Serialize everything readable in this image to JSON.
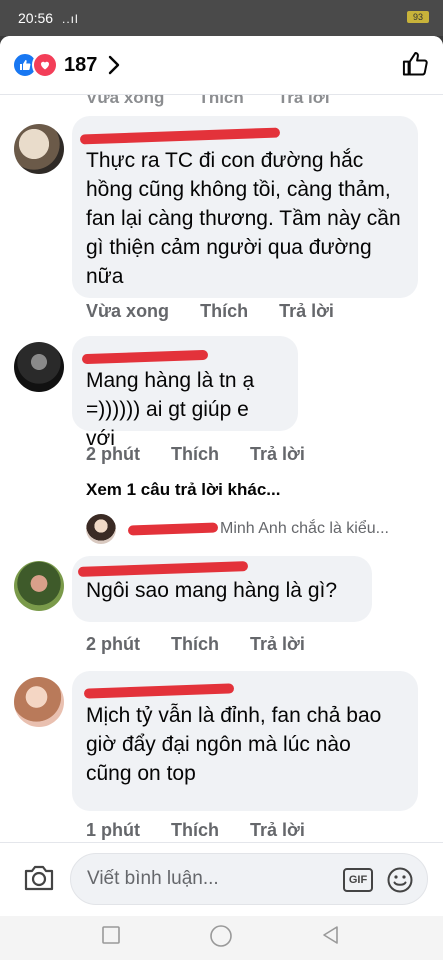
{
  "status": {
    "time": "20:56",
    "signal": "..ıl",
    "battery": "93"
  },
  "header": {
    "reaction_count": "187"
  },
  "ghost": {
    "time": "Vừa xong",
    "like": "Thích",
    "reply": "Trả lời"
  },
  "comments": [
    {
      "text": "Thực ra TC đi con đường hắc hồng cũng không tồi, càng thảm, fan lại càng thương. Tầm này cần gì thiện cảm người qua đường nữa",
      "time": "Vừa xong",
      "like": "Thích",
      "reply": "Trả lời"
    },
    {
      "text": "Mang hàng là tn ạ =)))))) ai gt giúp e với",
      "time": "2 phút",
      "like": "Thích",
      "reply": "Trả lời",
      "more_replies": "Xem 1 câu trả lời khác...",
      "reply_preview": "Minh Anh chắc là kiểu..."
    },
    {
      "text": "Ngôi sao mang hàng là gì?",
      "time": "2 phút",
      "like": "Thích",
      "reply": "Trả lời"
    },
    {
      "text": "Mịch tỷ vẫn là đỉnh, fan chả bao giờ đẩy đại ngôn mà lúc nào cũng on top",
      "time": "1 phút",
      "like": "Thích",
      "reply": "Trả lời"
    }
  ],
  "composer": {
    "placeholder": "Viết bình luận...",
    "gif": "GIF"
  },
  "icons": {
    "like": "like-icon",
    "love": "love-icon",
    "camera": "camera-icon",
    "emoji": "emoji-icon"
  },
  "colors": {
    "accent": "#1877f2",
    "love": "#f33e58",
    "bubble": "#f0f2f5",
    "redaction": "#e3323a"
  }
}
